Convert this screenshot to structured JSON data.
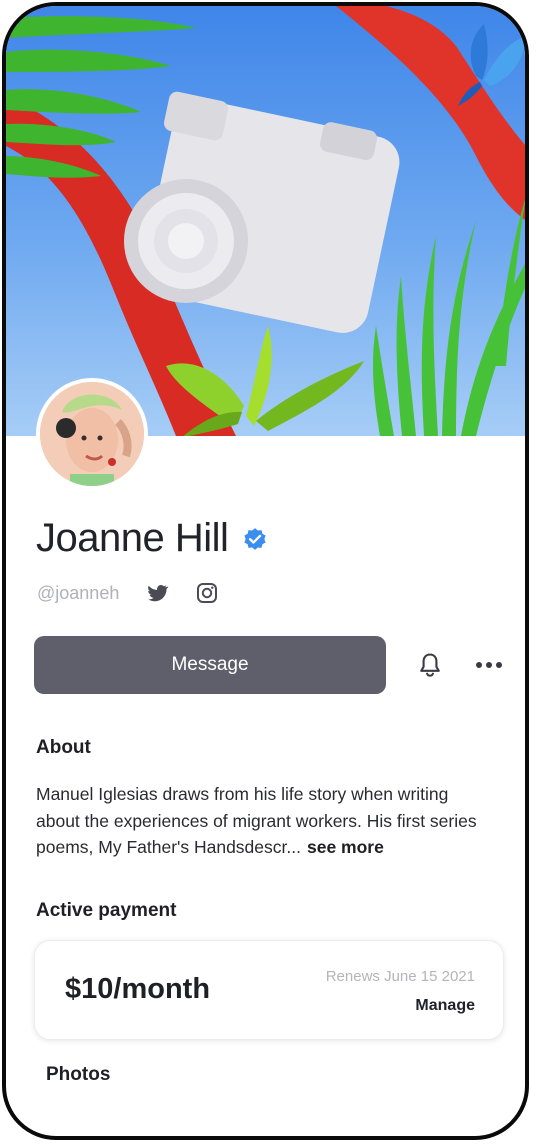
{
  "profile": {
    "name": "Joanne Hill",
    "handle": "@joanneh",
    "verified": true
  },
  "actions": {
    "message_label": "Message"
  },
  "about": {
    "heading": "About",
    "text": "Manuel Iglesias draws from his life story when writing about the experiences of migrant workers. His first series poems, My Father's Handsdescr...",
    "see_more": "see more"
  },
  "payment": {
    "heading": "Active payment",
    "price": "$10/month",
    "renews": "Renews June 15 2021",
    "manage_label": "Manage"
  },
  "photos": {
    "heading": "Photos"
  },
  "icons": {
    "verified": "verified-badge-icon",
    "twitter": "twitter-icon",
    "instagram": "instagram-icon",
    "bell": "bell-icon",
    "more": "more-horizontal-icon"
  },
  "colors": {
    "accent_button": "#5f5f6b",
    "verified_blue": "#3b8ef0",
    "muted_text": "#b0b0b8"
  }
}
